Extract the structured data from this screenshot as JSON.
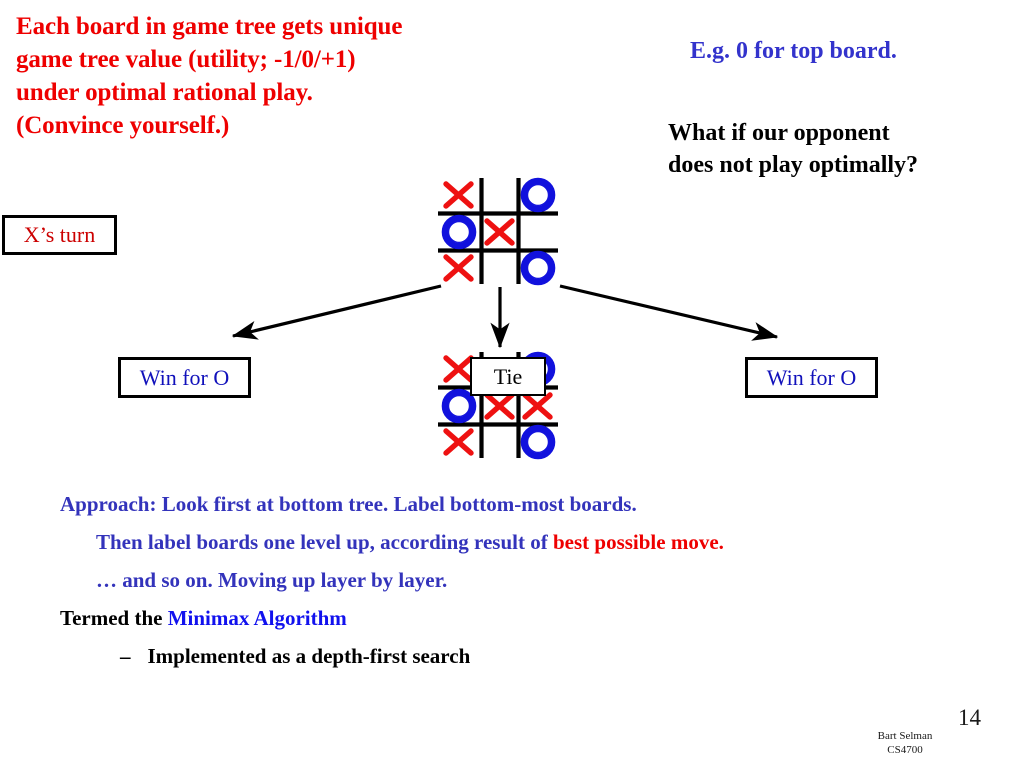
{
  "slide": {
    "intro_lines": [
      "Each board in game tree gets unique",
      "game tree value (utility; -1/0/+1)",
      "under optimal rational play.",
      "(Convince yourself.)"
    ],
    "eg_heading": "E.g. 0 for top board.",
    "question_lines": [
      "What if our opponent",
      "does not play optimally?"
    ]
  },
  "labels": {
    "x_turn": "X’s turn",
    "win_for_o_left": "Win for O",
    "win_for_o_right": "Win for O",
    "tie": "Tie"
  },
  "boards": {
    "top": {
      "name": "top-board",
      "cells": [
        "X",
        "",
        "O",
        "O",
        "X",
        "",
        "X",
        "",
        "O"
      ]
    },
    "bottom": {
      "name": "bottom-board",
      "cells": [
        "X",
        "",
        "O",
        "O",
        "X",
        "X",
        "X",
        "",
        "O"
      ]
    }
  },
  "approach": {
    "line1_label": "Approach:",
    "line1_rest": " Look first at bottom tree. Label bottom-most boards.",
    "line2_blue": "Then label boards one level up, according result of ",
    "line2_red": "best possible move.",
    "line3": "… and so on. Moving up layer by layer.",
    "line4_black": "Termed the ",
    "line4_blue": "Minimax Algorithm",
    "line5_dash": "–",
    "line5_text": "Implemented as a depth-first search"
  },
  "footer": {
    "page_number": "14",
    "author": "Bart Selman",
    "course": "CS4700"
  },
  "colors": {
    "x_mark": "#ee1111",
    "o_mark": "#1111dd",
    "grid": "#000000",
    "red_text": "#ee0000",
    "blue_text": "#3333bb",
    "blue_bright": "#1111ee",
    "black_text": "#000000"
  },
  "icons": {
    "arrow_left": "arrow-down-left-icon",
    "arrow_down": "arrow-down-icon",
    "arrow_right": "arrow-down-right-icon"
  }
}
